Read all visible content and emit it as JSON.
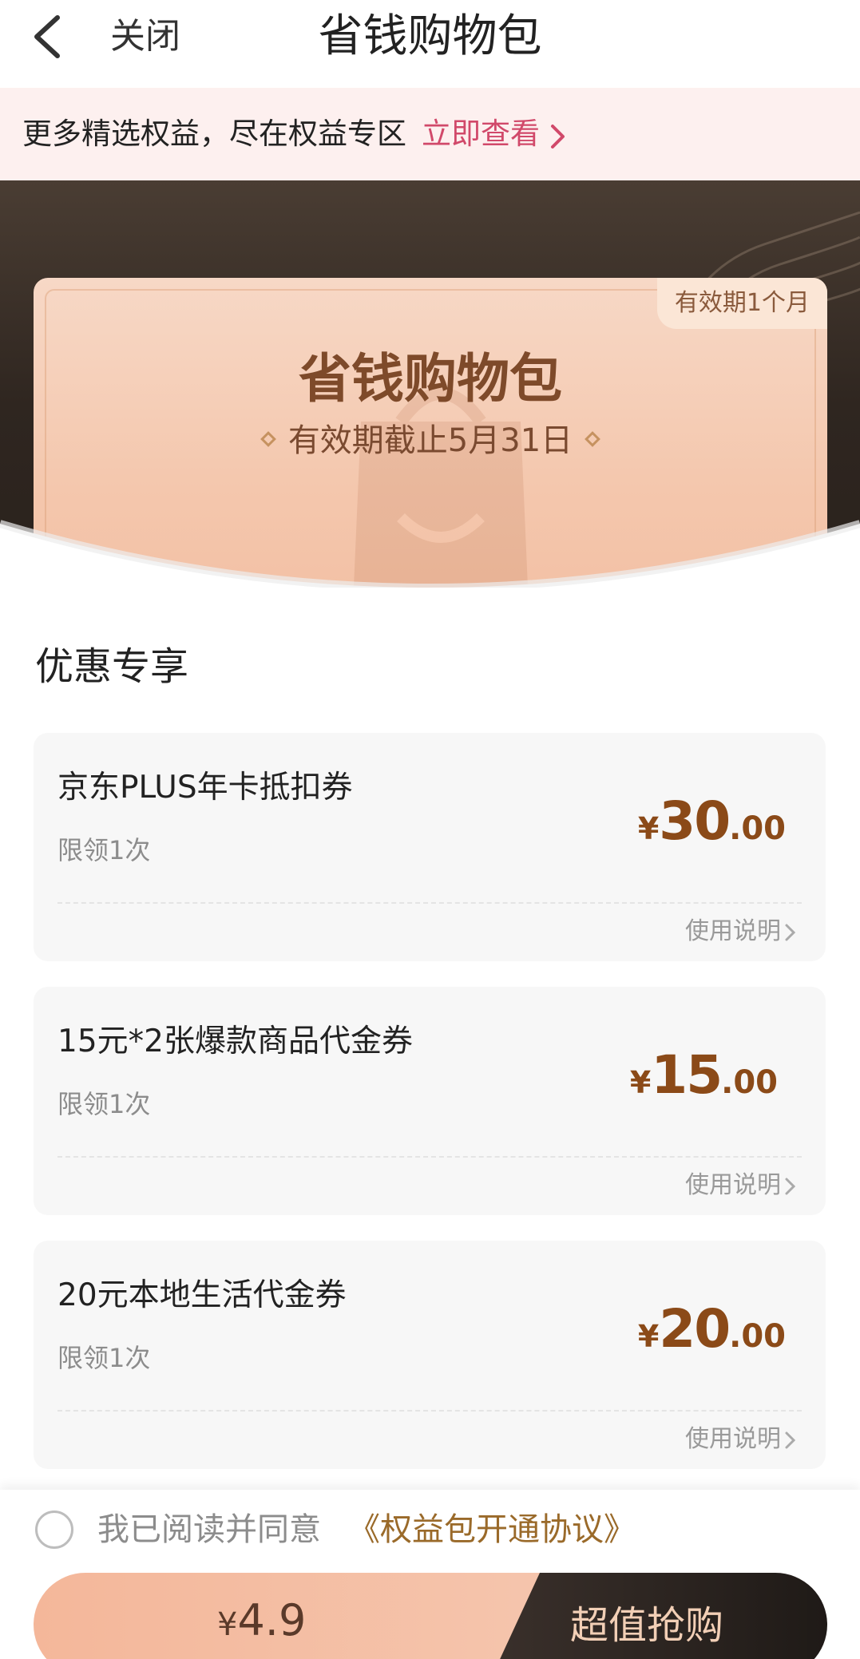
{
  "nav": {
    "back_icon": "chevron-left-icon",
    "close_label": "关闭",
    "title": "省钱购物包"
  },
  "promo": {
    "text": "更多精选权益，尽在权益专区",
    "link_label": "立即查看",
    "link_color": "#d1496a"
  },
  "hero": {
    "badge": "有效期1个月",
    "card_title": "省钱购物包",
    "card_subtitle": "有效期截止5月31日"
  },
  "section": {
    "title": "优惠专享"
  },
  "coupons": [
    {
      "name": "京东PLUS年卡抵扣券",
      "limit": "限领1次",
      "currency": "¥",
      "price_int": "30",
      "price_dec": ".00",
      "help": "使用说明"
    },
    {
      "name": "15元*2张爆款商品代金券",
      "limit": "限领1次",
      "currency": "¥",
      "price_int": "15",
      "price_dec": ".00",
      "help": "使用说明"
    },
    {
      "name": "20元本地生活代金券",
      "limit": "限领1次",
      "currency": "¥",
      "price_int": "20",
      "price_dec": ".00",
      "help": "使用说明"
    }
  ],
  "bottom": {
    "agree_text": "我已阅读并同意",
    "agree_link": "《权益包开通协议》",
    "agree_checked": false,
    "price_currency": "¥",
    "price": "4.9",
    "buy_label": "超值抢购"
  },
  "colors": {
    "accent_brown": "#8b4a18",
    "hero_dark": "#2f2620",
    "card_peach": "#f4c7ad"
  }
}
